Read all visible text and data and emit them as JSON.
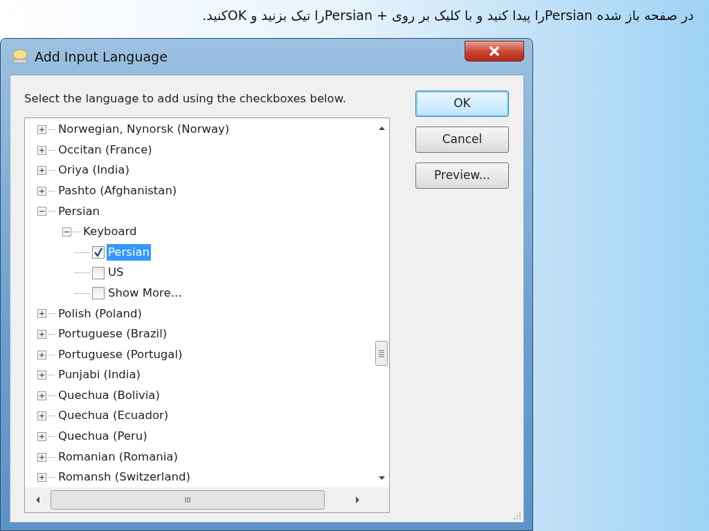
{
  "caption": "در صفحه باز شده  Persianرا پیدا کنید و با کلیک بر روی +  Persianرا تیک بزنید و  OKکنید.",
  "window": {
    "title": "Add Input Language"
  },
  "instruction": "Select the language to add using the checkboxes below.",
  "tree": [
    {
      "kind": "node",
      "label": "Norwegian, Nynorsk (Norway)",
      "expanded": false
    },
    {
      "kind": "node",
      "label": "Occitan (France)",
      "expanded": false
    },
    {
      "kind": "node",
      "label": "Oriya (India)",
      "expanded": false
    },
    {
      "kind": "node",
      "label": "Pashto (Afghanistan)",
      "expanded": false
    },
    {
      "kind": "node",
      "label": "Persian",
      "expanded": true,
      "children": [
        {
          "kind": "node",
          "label": "Keyboard",
          "expanded": true,
          "children": [
            {
              "kind": "checkbox",
              "label": "Persian",
              "checked": true,
              "selected": true
            },
            {
              "kind": "checkbox",
              "label": "US",
              "checked": false,
              "selected": false
            },
            {
              "kind": "checkbox",
              "label": "Show More...",
              "checked": false,
              "selected": false
            }
          ]
        }
      ]
    },
    {
      "kind": "node",
      "label": "Polish (Poland)",
      "expanded": false
    },
    {
      "kind": "node",
      "label": "Portuguese (Brazil)",
      "expanded": false
    },
    {
      "kind": "node",
      "label": "Portuguese (Portugal)",
      "expanded": false
    },
    {
      "kind": "node",
      "label": "Punjabi (India)",
      "expanded": false
    },
    {
      "kind": "node",
      "label": "Quechua (Bolivia)",
      "expanded": false
    },
    {
      "kind": "node",
      "label": "Quechua (Ecuador)",
      "expanded": false
    },
    {
      "kind": "node",
      "label": "Quechua (Peru)",
      "expanded": false
    },
    {
      "kind": "node",
      "label": "Romanian (Romania)",
      "expanded": false
    },
    {
      "kind": "node",
      "label": "Romansh (Switzerland)",
      "expanded": false
    }
  ],
  "buttons": [
    {
      "label": "OK",
      "default": true
    },
    {
      "label": "Cancel",
      "default": false
    },
    {
      "label": "Preview...",
      "default": false
    }
  ]
}
